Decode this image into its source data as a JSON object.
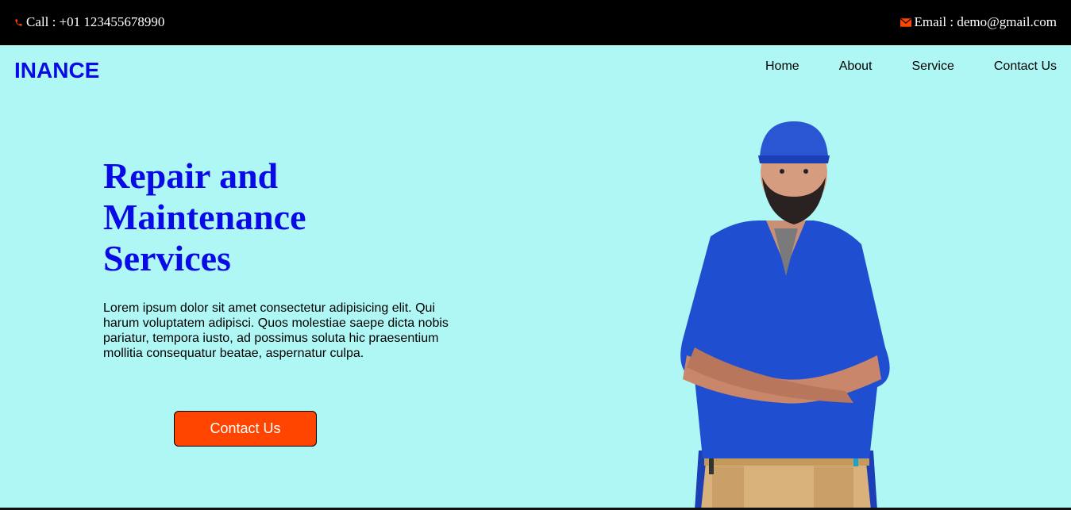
{
  "topbar": {
    "call_text": "Call : +01 123455678990",
    "email_text": "Email : demo@gmail.com",
    "phone_icon": "phone-icon",
    "email_icon": "envelope-icon",
    "icon_color": "#ff4500"
  },
  "brand": {
    "logo": "INANCE"
  },
  "nav": {
    "items": [
      {
        "label": "Home"
      },
      {
        "label": "About"
      },
      {
        "label": "Service"
      },
      {
        "label": "Contact Us"
      }
    ]
  },
  "hero": {
    "title_line1": "Repair and",
    "title_line2": "Maintenance",
    "title_line3": "Services",
    "description": "Lorem ipsum dolor sit amet consectetur adipisicing elit. Qui harum voluptatem adipisci. Quos molestiae saepe dicta nobis pariatur, tempora iusto, ad possimus soluta hic praesentium mollitia consequatur beatae, aspernatur culpa.",
    "cta_label": "Contact Us"
  },
  "colors": {
    "background": "#aff7f5",
    "accent": "#ff4500",
    "brand_blue": "#0a0ae6",
    "topbar": "#000000"
  }
}
